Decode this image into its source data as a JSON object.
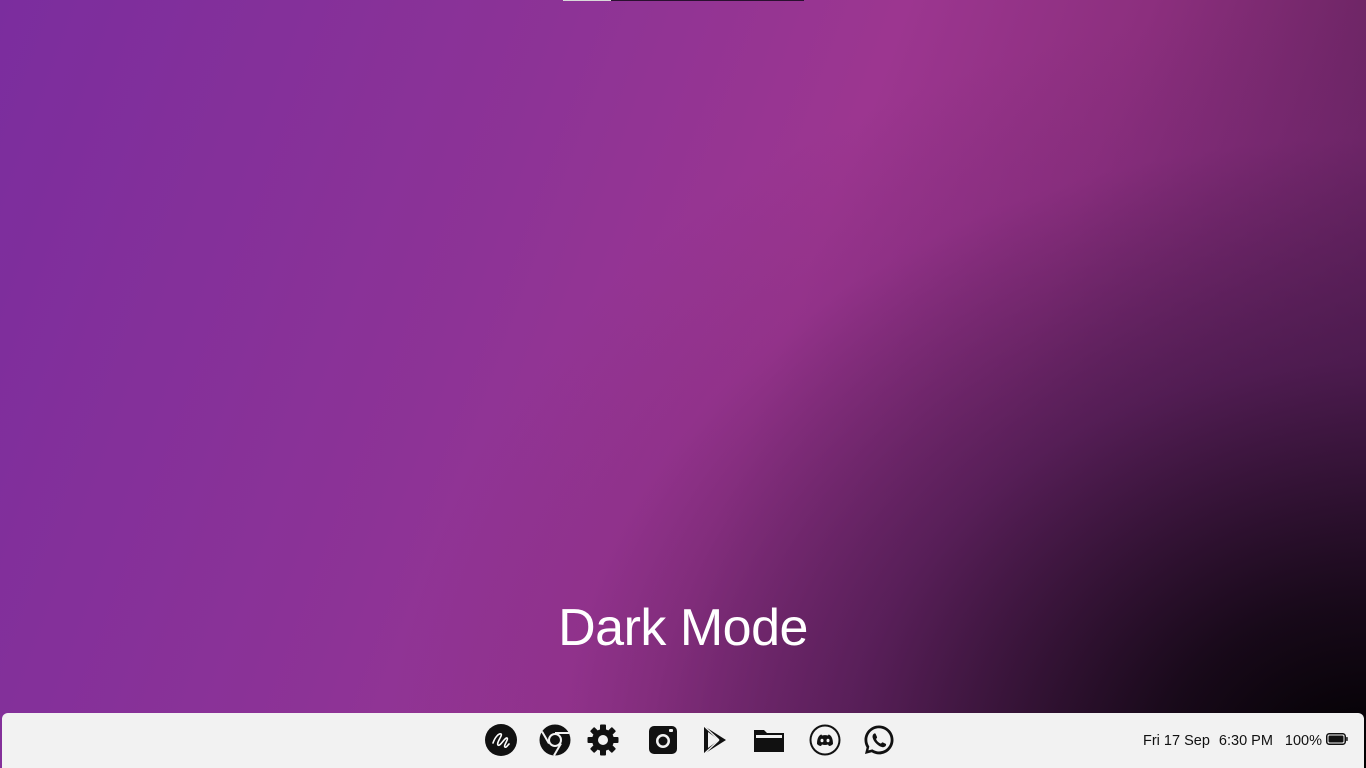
{
  "desktop": {
    "label": "Dark Mode"
  },
  "dock": {
    "apps": [
      {
        "name": "notes-app",
        "icon": "scribble-icon"
      },
      {
        "name": "chrome",
        "icon": "chrome-icon"
      },
      {
        "name": "settings",
        "icon": "gear-icon"
      },
      {
        "name": "camera",
        "icon": "camera-icon"
      },
      {
        "name": "play-store",
        "icon": "play-store-icon"
      },
      {
        "name": "files",
        "icon": "folder-icon"
      },
      {
        "name": "discord",
        "icon": "discord-icon"
      },
      {
        "name": "whatsapp",
        "icon": "whatsapp-icon"
      }
    ]
  },
  "tray": {
    "date": "Fri 17 Sep",
    "time": "6:30 PM",
    "battery": "100%",
    "battery_level": 1.0
  }
}
